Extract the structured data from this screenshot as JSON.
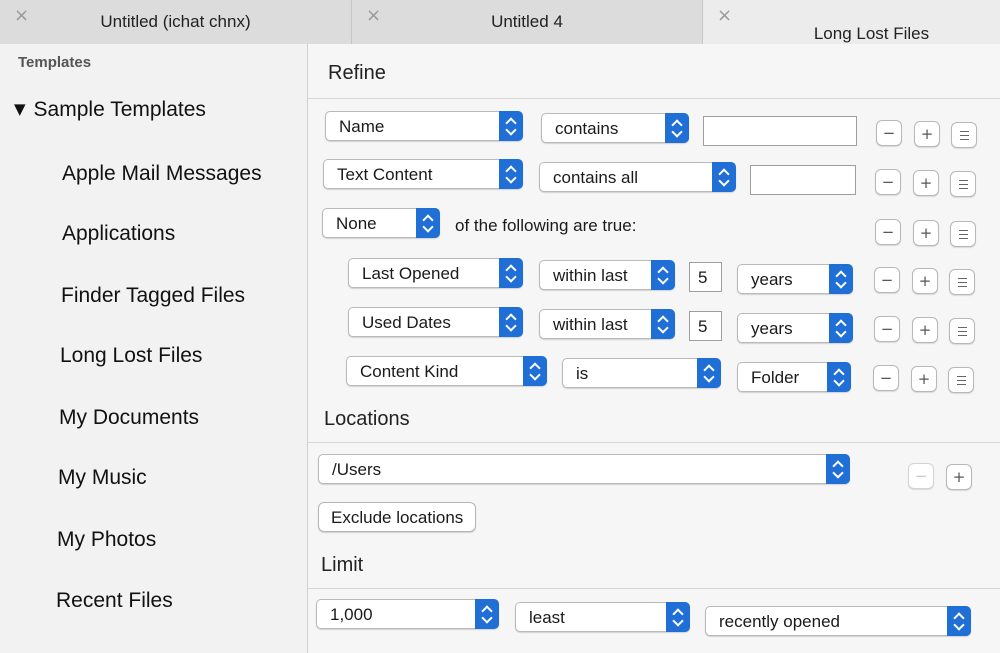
{
  "tabs": [
    {
      "title": "Untitled (ichat chnx)",
      "close": "×"
    },
    {
      "title": "Untitled 4",
      "close": "×"
    },
    {
      "title": "Long Lost Files",
      "close": "×"
    }
  ],
  "sidebar": {
    "heading": "Templates",
    "group": {
      "toggle": "▼",
      "label": "Sample Templates"
    },
    "items": [
      "Apple Mail Messages",
      "Applications",
      "Finder Tagged Files",
      "Long Lost Files",
      "My Documents",
      "My Music",
      "My Photos",
      "Recent Files"
    ]
  },
  "refine": {
    "title": "Refine",
    "rows": [
      {
        "attribute": "Name",
        "operator": "contains",
        "value": ""
      },
      {
        "attribute": "Text Content",
        "operator": "contains all",
        "value": ""
      },
      {
        "attribute": "None",
        "static": "of the following are true:"
      },
      {
        "attribute": "Last Opened",
        "operator": "within last",
        "value": "5",
        "unit": "years"
      },
      {
        "attribute": "Used Dates",
        "operator": "within last",
        "value": "5",
        "unit": "years"
      },
      {
        "attribute": "Content Kind",
        "operator": "is",
        "unit": "Folder"
      }
    ],
    "row_buttons": {
      "minus": "−",
      "plus": "+"
    }
  },
  "locations": {
    "title": "Locations",
    "path": "/Users",
    "exclude_label": "Exclude locations",
    "minus": "−",
    "plus": "+"
  },
  "limit": {
    "title": "Limit",
    "count": "1,000",
    "mode": "least",
    "criteria": "recently opened"
  }
}
